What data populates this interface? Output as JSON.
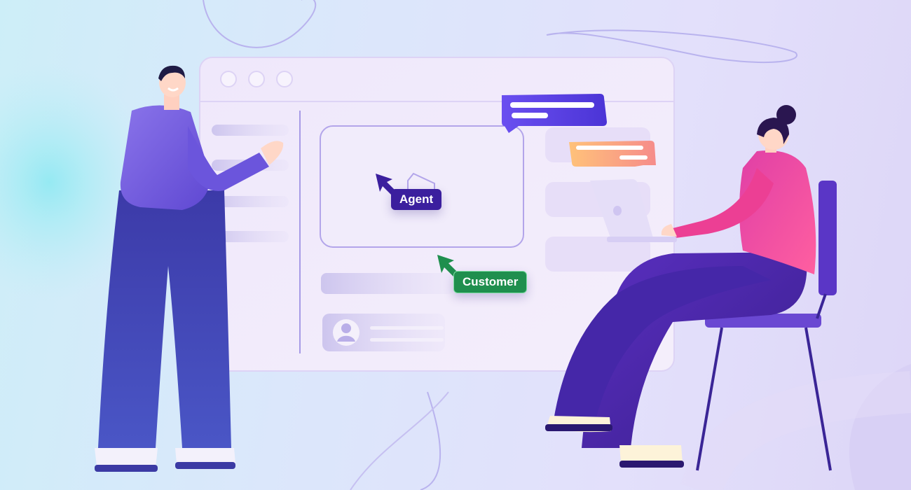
{
  "cursors": {
    "agent_label": "Agent",
    "customer_label": "Customer"
  },
  "icons": {
    "agent_cursor": "cursor-arrow-icon",
    "customer_cursor": "cursor-arrow-icon",
    "avatar": "user-avatar-icon",
    "laptop": "laptop-icon"
  },
  "colors": {
    "agent_cursor": "#3b1f9e",
    "customer_cursor": "#1f8f4e",
    "chat_bubble_primary": "#6a4ff0",
    "chat_bubble_secondary": "#f7a06a",
    "agent_shirt": "#7b63e0",
    "agent_pants": "#3e3fae",
    "customer_sweater": "#f0449c",
    "customer_pants": "#4a2aa8"
  }
}
